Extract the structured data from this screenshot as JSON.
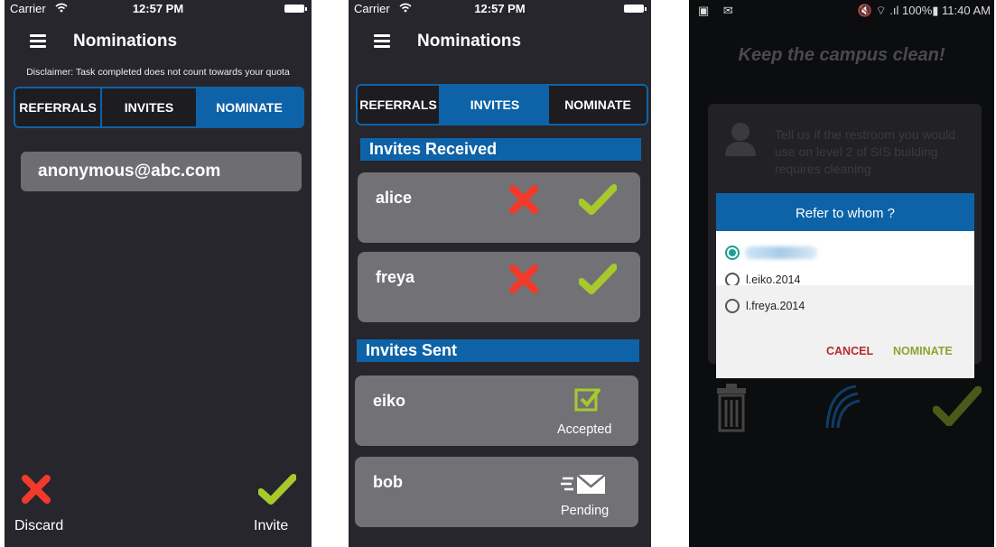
{
  "screen1": {
    "status": {
      "carrier": "Carrier",
      "time": "12:57 PM"
    },
    "title": "Nominations",
    "disclaimer": "Disclaimer: Task completed does not count towards your quota",
    "tabs": [
      "REFERRALS",
      "INVITES",
      "NOMINATE"
    ],
    "active_tab": "NOMINATE",
    "email": "anonymous@abc.com",
    "discard_label": "Discard",
    "invite_label": "Invite"
  },
  "screen2": {
    "status": {
      "carrier": "Carrier",
      "time": "12:57 PM"
    },
    "title": "Nominations",
    "tabs": [
      "REFERRALS",
      "INVITES",
      "NOMINATE"
    ],
    "active_tab": "INVITES",
    "received_header": "Invites Received",
    "received": [
      {
        "name": "alice"
      },
      {
        "name": "freya"
      }
    ],
    "sent_header": "Invites Sent",
    "sent": [
      {
        "name": "eiko",
        "status": "Accepted"
      },
      {
        "name": "bob",
        "status": "Pending"
      }
    ]
  },
  "screen3": {
    "status": {
      "icons_left": "▣ ✉",
      "right": "🔇 ⌔ .ıl 100%▮ 11:40 AM"
    },
    "slogan": "Keep the campus clean!",
    "question": "Tell us if the restroom you would use on level 2 of SIS building requires cleaning",
    "dialog": {
      "title": "Refer to whom ?",
      "options": [
        "l.eiko.2014",
        "l.freya.2014"
      ],
      "cancel": "CANCEL",
      "nominate": "NOMINATE"
    }
  },
  "colors": {
    "accent_blue": "#0e63a8",
    "reject_red": "#f23a2a",
    "accept_green": "#a8c92b",
    "cancel_red": "#b5292c",
    "nominate_green": "#8aa531"
  }
}
